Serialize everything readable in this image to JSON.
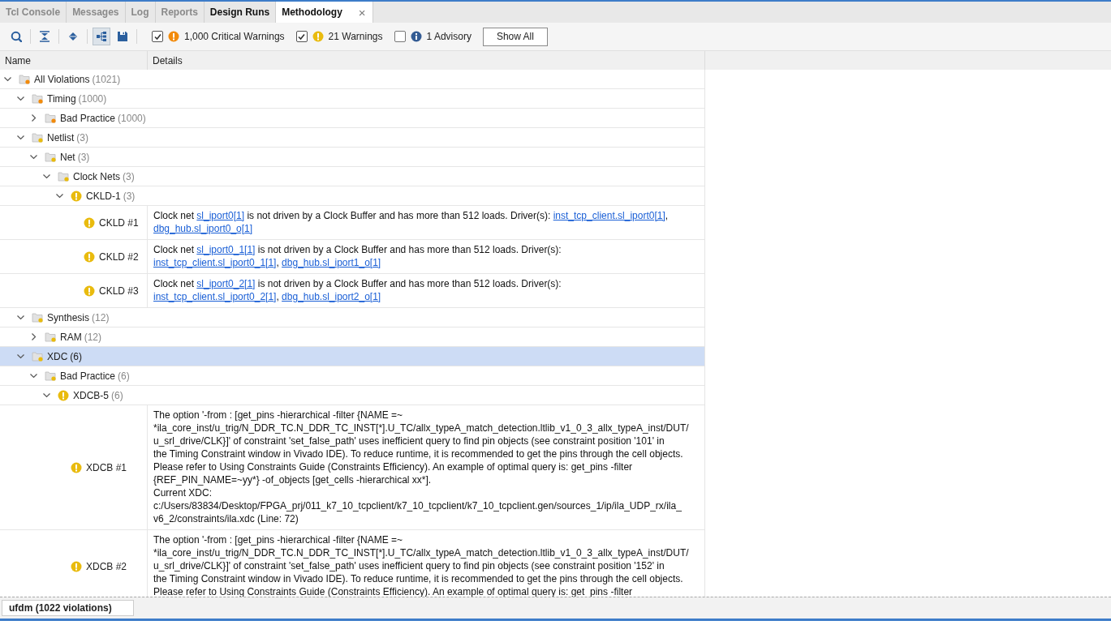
{
  "tabs": [
    {
      "label": "Tcl Console",
      "selected": false,
      "dimmed": true
    },
    {
      "label": "Messages",
      "selected": false,
      "dimmed": true
    },
    {
      "label": "Log",
      "selected": false,
      "dimmed": true
    },
    {
      "label": "Reports",
      "selected": false,
      "dimmed": true
    },
    {
      "label": "Design Runs",
      "selected": false,
      "dimmed": false
    },
    {
      "label": "Methodology",
      "selected": true,
      "dimmed": false,
      "close": "×"
    }
  ],
  "toolbar": {
    "buttons": [
      {
        "kind": "search",
        "pressed": false
      },
      {
        "kind": "collapse",
        "pressed": false
      },
      {
        "kind": "expand",
        "pressed": false
      },
      {
        "kind": "hierarchy",
        "pressed": true
      },
      {
        "kind": "save",
        "pressed": false
      }
    ],
    "filters": [
      {
        "label": "1,000 Critical Warnings",
        "kind": "alert",
        "color": "#f28b0c",
        "checked": true
      },
      {
        "label": "21 Warnings",
        "kind": "alert",
        "color": "#e9bb0e",
        "checked": true
      },
      {
        "label": "1 Advisory",
        "kind": "info",
        "color": "#345c94",
        "checked": false
      }
    ],
    "show_all": "Show All"
  },
  "table": {
    "columns": [
      "Name",
      "Details"
    ],
    "rows": [
      {
        "label": "All Violations",
        "count": "(1021)",
        "kind": "folder",
        "color": "#f28b0c",
        "expanded": true,
        "selected": false,
        "children": [
          {
            "label": "Timing",
            "count": "(1000)",
            "kind": "folder",
            "color": "#f28b0c",
            "expanded": true,
            "selected": false,
            "children": [
              {
                "label": "Bad Practice",
                "count": "(1000)",
                "kind": "folder",
                "color": "#f28b0c",
                "expanded": false,
                "selected": false
              }
            ]
          },
          {
            "label": "Netlist",
            "count": "(3)",
            "kind": "folder",
            "color": "#e9bb0e",
            "expanded": true,
            "selected": false,
            "children": [
              {
                "label": "Net",
                "count": "(3)",
                "kind": "folder",
                "color": "#e9bb0e",
                "expanded": true,
                "selected": false,
                "children": [
                  {
                    "label": "Clock Nets",
                    "count": "(3)",
                    "kind": "folder",
                    "color": "#e9bb0e",
                    "expanded": true,
                    "selected": false,
                    "children": [
                      {
                        "label": "CKLD-1",
                        "count": "(3)",
                        "kind": "rule",
                        "color": "#e9bb0e",
                        "expanded": true,
                        "selected": false,
                        "children": [
                          {
                            "label": "CKLD #1",
                            "kind": "violation",
                            "color": "#e9bb0e",
                            "selected": false,
                            "details": [
                              [
                                {
                                  "text": "Clock net "
                                },
                                {
                                  "text": "sl_iport0[1]",
                                  "link": true
                                },
                                {
                                  "text": " is not driven by a Clock Buffer and has more than 512 loads. Driver(s): "
                                },
                                {
                                  "text": "inst_tcp_client.sl_iport0[1]",
                                  "link": true
                                },
                                {
                                  "text": ","
                                }
                              ],
                              [
                                {
                                  "text": "dbg_hub.sl_iport0_o[1]",
                                  "link": true
                                }
                              ]
                            ]
                          },
                          {
                            "label": "CKLD #2",
                            "kind": "violation",
                            "color": "#e9bb0e",
                            "selected": false,
                            "details": [
                              [
                                {
                                  "text": "Clock net "
                                },
                                {
                                  "text": "sl_iport0_1[1]",
                                  "link": true
                                },
                                {
                                  "text": " is not driven by a Clock Buffer and has more than 512 loads. Driver(s):"
                                }
                              ],
                              [
                                {
                                  "text": "inst_tcp_client.sl_iport0_1[1]",
                                  "link": true
                                },
                                {
                                  "text": ", "
                                },
                                {
                                  "text": "dbg_hub.sl_iport1_o[1]",
                                  "link": true
                                }
                              ]
                            ]
                          },
                          {
                            "label": "CKLD #3",
                            "kind": "violation",
                            "color": "#e9bb0e",
                            "selected": false,
                            "details": [
                              [
                                {
                                  "text": "Clock net "
                                },
                                {
                                  "text": "sl_iport0_2[1]",
                                  "link": true
                                },
                                {
                                  "text": " is not driven by a Clock Buffer and has more than 512 loads. Driver(s):"
                                }
                              ],
                              [
                                {
                                  "text": "inst_tcp_client.sl_iport0_2[1]",
                                  "link": true
                                },
                                {
                                  "text": ", "
                                },
                                {
                                  "text": "dbg_hub.sl_iport2_o[1]",
                                  "link": true
                                }
                              ]
                            ]
                          }
                        ]
                      }
                    ]
                  }
                ]
              }
            ]
          },
          {
            "label": "Synthesis",
            "count": "(12)",
            "kind": "folder",
            "color": "#e9bb0e",
            "expanded": true,
            "selected": false,
            "children": [
              {
                "label": "RAM",
                "count": "(12)",
                "kind": "folder",
                "color": "#e9bb0e",
                "expanded": false,
                "selected": false
              }
            ]
          },
          {
            "label": "XDC",
            "count": "(6)",
            "kind": "folder",
            "color": "#e9bb0e",
            "expanded": true,
            "selected": true,
            "children": [
              {
                "label": "Bad Practice",
                "count": "(6)",
                "kind": "folder",
                "color": "#e9bb0e",
                "expanded": true,
                "selected": false,
                "children": [
                  {
                    "label": "XDCB-5",
                    "count": "(6)",
                    "kind": "rule",
                    "color": "#e9bb0e",
                    "expanded": true,
                    "selected": false,
                    "children": [
                      {
                        "label": "XDCB #1",
                        "kind": "violation",
                        "color": "#e9bb0e",
                        "selected": false,
                        "details": [
                          [
                            {
                              "text": "The option '-from : [get_pins -hierarchical -filter {NAME =~"
                            }
                          ],
                          [
                            {
                              "text": "*ila_core_inst/u_trig/N_DDR_TC.N_DDR_TC_INST[*].U_TC/allx_typeA_match_detection.ltlib_v1_0_3_allx_typeA_inst/DUT/"
                            }
                          ],
                          [
                            {
                              "text": "u_srl_drive/CLK}]' of constraint 'set_false_path' uses inefficient query to find pin objects (see constraint position '101' in"
                            }
                          ],
                          [
                            {
                              "text": "the Timing Constraint window in Vivado IDE). To reduce runtime, it is recommended to get the pins through the cell objects."
                            }
                          ],
                          [
                            {
                              "text": "Please refer to Using Constraints Guide (Constraints Efficiency). An example of optimal query is: get_pins -filter"
                            }
                          ],
                          [
                            {
                              "text": "{REF_PIN_NAME=~yy*} -of_objects [get_cells -hierarchical xx*]."
                            }
                          ],
                          [
                            {
                              "text": "Current XDC:"
                            }
                          ],
                          [
                            {
                              "text": "c:/Users/83834/Desktop/FPGA_prj/011_k7_10_tcpclient/k7_10_tcpclient/k7_10_tcpclient.gen/sources_1/ip/ila_UDP_rx/ila_"
                            }
                          ],
                          [
                            {
                              "text": "v6_2/constraints/ila.xdc (Line: 72)"
                            }
                          ]
                        ]
                      },
                      {
                        "label": "XDCB #2",
                        "kind": "violation",
                        "color": "#e9bb0e",
                        "selected": false,
                        "details": [
                          [
                            {
                              "text": "The option '-from : [get_pins -hierarchical -filter {NAME =~"
                            }
                          ],
                          [
                            {
                              "text": "*ila_core_inst/u_trig/N_DDR_TC.N_DDR_TC_INST[*].U_TC/allx_typeA_match_detection.ltlib_v1_0_3_allx_typeA_inst/DUT/"
                            }
                          ],
                          [
                            {
                              "text": "u_srl_drive/CLK}]' of constraint 'set_false_path' uses inefficient query to find pin objects (see constraint position '152' in"
                            }
                          ],
                          [
                            {
                              "text": "the Timing Constraint window in Vivado IDE). To reduce runtime, it is recommended to get the pins through the cell objects."
                            }
                          ],
                          [
                            {
                              "text": "Please refer to Using Constraints Guide (Constraints Efficiency). An example of optimal query is: get_pins -filter"
                            }
                          ]
                        ]
                      }
                    ]
                  }
                ]
              }
            ]
          }
        ]
      }
    ]
  },
  "status_tab": "ufdm (1022 violations)"
}
